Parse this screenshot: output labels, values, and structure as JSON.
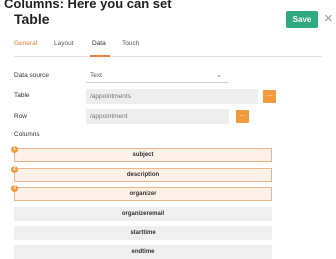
{
  "window": {
    "cut_text": "Columns: Here you can set",
    "title": "Table",
    "save_label": "Save"
  },
  "tabs": [
    {
      "label": "General",
      "state": "accent"
    },
    {
      "label": "Layout",
      "state": "normal"
    },
    {
      "label": "Data",
      "state": "active"
    },
    {
      "label": "Touch",
      "state": "normal"
    }
  ],
  "fields": {
    "data_source": {
      "label": "Data source",
      "value": "Text"
    },
    "table": {
      "label": "Table",
      "value": "/appointments",
      "browse": "..."
    },
    "row": {
      "label": "Row",
      "value": "/appointment",
      "browse": "..."
    },
    "columns_label": "Columns"
  },
  "columns": [
    {
      "name": "subject",
      "selected": true,
      "badge": "1"
    },
    {
      "name": "description",
      "selected": true,
      "badge": "2"
    },
    {
      "name": "organizer",
      "selected": true,
      "badge": "3"
    },
    {
      "name": "organizeremail",
      "selected": false,
      "badge": ""
    },
    {
      "name": "starttime",
      "selected": false,
      "badge": ""
    },
    {
      "name": "endtime",
      "selected": false,
      "badge": ""
    }
  ],
  "colors": {
    "accent": "#e8823a",
    "save": "#2eaa7e",
    "button": "#f39a3c",
    "selected_bg": "#fdf1ea"
  }
}
